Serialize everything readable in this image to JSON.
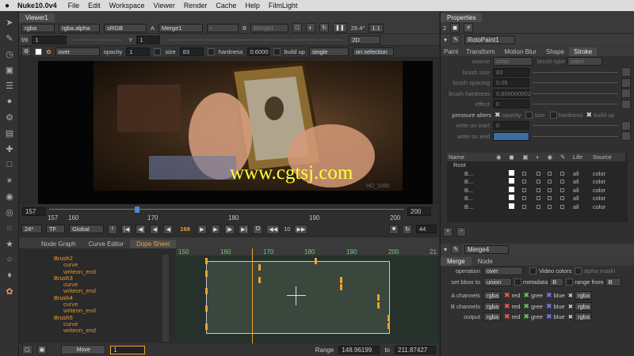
{
  "menubar": {
    "app": "Nuke10.0v4",
    "items": [
      "File",
      "Edit",
      "Workspace",
      "Viewer",
      "Render",
      "Cache",
      "Help",
      "FilmLight"
    ]
  },
  "viewer": {
    "tab": "Viewer1",
    "channels": "rgba",
    "alpha": "rgba.alpha",
    "colorspace": "sRGB",
    "a_input": "Merge1",
    "b_letter": "B",
    "a_letter": "A",
    "dash": "-",
    "b_input": "Merge1",
    "zoom": "29.4°",
    "ratio": "1:1",
    "fstop": "f/8",
    "fstop_val": "1",
    "y_label": "Y",
    "y_val": "1",
    "view": "2D",
    "paint_mode": "over",
    "opacity_label": "opacity",
    "opacity": "1",
    "size_label": "size",
    "size": "83",
    "hardness_label": "hardness",
    "hardness": "0.6000",
    "buildup_label": "build up",
    "single": "single",
    "on_selection": "on selection",
    "format": "HD_1080",
    "watermark": "www.cgtsj.com"
  },
  "timeline": {
    "start": "157",
    "end": "200",
    "ticks": [
      "157",
      "160",
      "170",
      "180",
      "190",
      "200"
    ],
    "fps": "24*",
    "tf": "TF",
    "global": "Global",
    "frame": "168",
    "step": "10",
    "end_frame": "44"
  },
  "bottomtabs": [
    "Node Graph",
    "Curve Editor",
    "Dope Sheet"
  ],
  "tree": [
    {
      "label": "Brush2",
      "indent": 0
    },
    {
      "label": "curve",
      "indent": 1
    },
    {
      "label": "writeon_end",
      "indent": 1
    },
    {
      "label": "Brush3",
      "indent": 0
    },
    {
      "label": "curve",
      "indent": 1
    },
    {
      "label": "writeon_end",
      "indent": 1
    },
    {
      "label": "Brush4",
      "indent": 0
    },
    {
      "label": "curve",
      "indent": 1
    },
    {
      "label": "writeon_end",
      "indent": 1
    },
    {
      "label": "Brush5",
      "indent": 0
    },
    {
      "label": "curve",
      "indent": 1
    },
    {
      "label": "writeon_end",
      "indent": 1
    }
  ],
  "dope": {
    "ruler": [
      "150",
      "160",
      "170",
      "180",
      "190",
      "200",
      "21"
    ]
  },
  "status": {
    "move_label": "Move",
    "move_val": "1",
    "range_label": "Range",
    "range_from": "148.96199",
    "to_label": "to",
    "range_to": "211.87427"
  },
  "properties": {
    "title": "Properties",
    "count": "2",
    "roto_node": "RotoPaint1",
    "roto_tabs": [
      "Paint",
      "Transform",
      "Motion Blur",
      "Shape",
      "Stroke"
    ],
    "source_label": "source",
    "source_val": "color",
    "brush_type_label": "brush type",
    "brush_type_val": "paint",
    "brush_size_label": "brush size",
    "brush_size": "83",
    "brush_spacing_label": "brush spacing",
    "brush_spacing": "0.05",
    "brush_hardness_label": "brush hardness",
    "brush_hardness": "0.600000002",
    "effect_label": "effect",
    "effect": "0",
    "pressure_label": "pressure alters",
    "p_opacity": "opacity",
    "p_size": "size",
    "p_hardness": "hardness",
    "p_buildup": "build up",
    "write_start_label": "write on start",
    "write_start": "0",
    "write_end_label": "write on end",
    "write_end": "",
    "layer_headers": {
      "name": "Name",
      "life": "Life",
      "source": "Source"
    },
    "layers": [
      {
        "name": "Root",
        "life": "",
        "source": ""
      },
      {
        "name": "B...",
        "life": "all",
        "source": "color"
      },
      {
        "name": "B...",
        "life": "all",
        "source": "color"
      },
      {
        "name": "B...",
        "life": "all",
        "source": "color"
      },
      {
        "name": "B...",
        "life": "all",
        "source": "color"
      },
      {
        "name": "B...",
        "life": "all",
        "source": "color"
      }
    ],
    "merge_node": "Merge4",
    "merge_tabs": [
      "Merge",
      "Node"
    ],
    "operation_label": "operation",
    "operation": "over",
    "video_colors": "Video colors",
    "alpha_masking": "alpha maski",
    "bbox_label": "set bbox to",
    "bbox": "union",
    "metadata": "metadata",
    "metadata_val": "B",
    "range_label": "range from",
    "range_val": "B",
    "a_channels_label": "A channels",
    "b_channels_label": "B channels",
    "output_label": "output",
    "chan": "rgba",
    "red": "red",
    "green": "gree",
    "blue": "blue"
  }
}
